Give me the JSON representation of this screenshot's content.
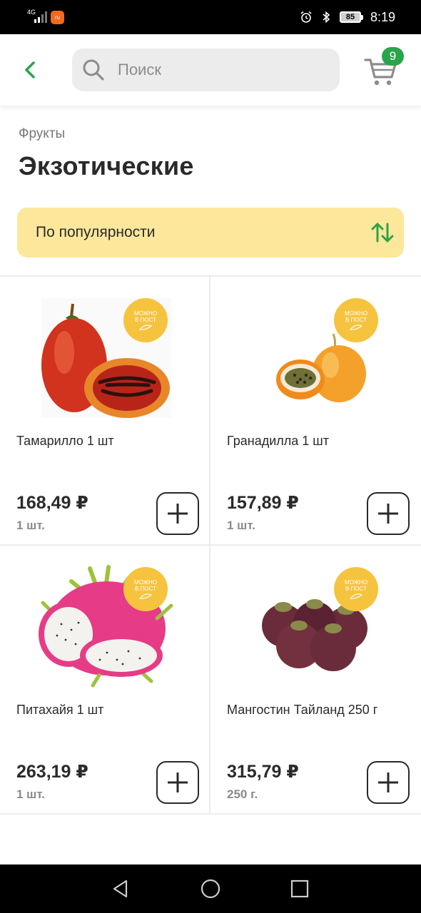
{
  "status_bar": {
    "network": "4G",
    "app_icon_text": "ru",
    "battery": "85",
    "time": "8:19"
  },
  "header": {
    "search": {
      "placeholder": "Поиск"
    },
    "cart": {
      "count": "9"
    }
  },
  "breadcrumb": "Фрукты",
  "title": "Экзотические",
  "sort": {
    "label": "По популярности"
  },
  "badge": {
    "line1": "МОЖНО",
    "line2": "В ПОСТ"
  },
  "products": [
    {
      "name": "Тамарилло 1 шт",
      "price": "168,49 ₽",
      "unit": "1 шт.",
      "image": "tamarillo"
    },
    {
      "name": "Гранадилла 1 шт",
      "price": "157,89 ₽",
      "unit": "1 шт.",
      "image": "granadilla"
    },
    {
      "name": "Питахайя 1 шт",
      "price": "263,19 ₽",
      "unit": "1 шт.",
      "image": "pitahaya"
    },
    {
      "name": "Мангостин Тайланд 250 г",
      "price": "315,79 ₽",
      "unit": "250 г.",
      "image": "mangosteen"
    }
  ],
  "colors": {
    "accent_green": "#2aa44a",
    "sort_bg": "#fde79b",
    "badge_yellow": "#f6c33e"
  }
}
